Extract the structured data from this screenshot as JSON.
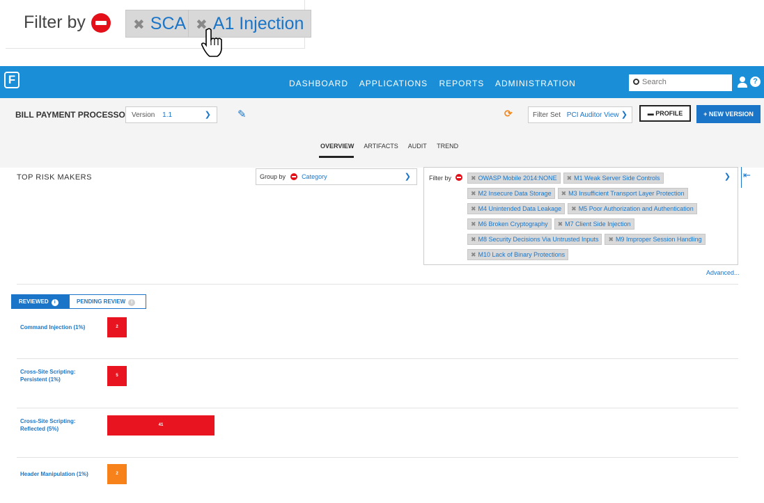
{
  "zoom_callout": {
    "filter_label": "Filter by",
    "chips": [
      {
        "label": "SCA"
      },
      {
        "label": "A1 Injection"
      }
    ]
  },
  "nav": {
    "links": [
      "DASHBOARD",
      "APPLICATIONS",
      "REPORTS",
      "ADMINISTRATION"
    ],
    "search_placeholder": "Search",
    "help": "?",
    "logo": "F"
  },
  "header": {
    "app_name": "BILL PAYMENT PROCESSOR",
    "version_label": "Version",
    "version_value": "1.1",
    "filter_set_label": "Filter Set",
    "filter_set_value": "PCI Auditor View",
    "profile_label": "PROFILE",
    "new_version_label": "+ NEW VERSION"
  },
  "tabs": [
    {
      "label": "OVERVIEW",
      "active": true
    },
    {
      "label": "ARTIFACTS",
      "active": false
    },
    {
      "label": "AUDIT",
      "active": false
    },
    {
      "label": "TREND",
      "active": false
    }
  ],
  "section": {
    "title": "TOP RISK MAKERS",
    "group_by_label": "Group by",
    "group_by_value": "Category",
    "filter_by_label": "Filter by",
    "advanced_link": "Advanced...",
    "filter_chips": [
      "OWASP Mobile 2014:NONE",
      "M1 Weak Server Side Controls",
      "M2 Insecure Data Storage",
      "M3 Insufficient Transport Layer Protection",
      "M4 Unintended Data Leakage",
      "M5 Poor Authorization and Authentication",
      "M6 Broken Cryptography",
      "M7 Client Side Injection",
      "M8 Security Decisions Via Untrusted Inputs",
      "M9 Improper Session Handling",
      "M10 Lack of Binary Protections"
    ]
  },
  "review_toggle": {
    "reviewed": "REVIEWED",
    "pending": "PENDING REVIEW",
    "info": "i"
  },
  "colors": {
    "accent": "#1a75c9",
    "nav": "#1a8fd8",
    "critical": "#e8141f",
    "high": "#f7821b"
  },
  "chart_data": {
    "type": "bar",
    "categories": [
      "Command Injection (1%)",
      "Cross-Site Scripting: Persistent (1%)",
      "Cross-Site Scripting: Reflected (5%)",
      "Header Manipulation (1%)"
    ],
    "values": [
      2,
      5,
      41,
      2
    ],
    "value_labels": [
      "2",
      "5",
      "41",
      "2"
    ],
    "bar_colors": [
      "#e8141f",
      "#e8141f",
      "#e8141f",
      "#f7821b"
    ]
  }
}
